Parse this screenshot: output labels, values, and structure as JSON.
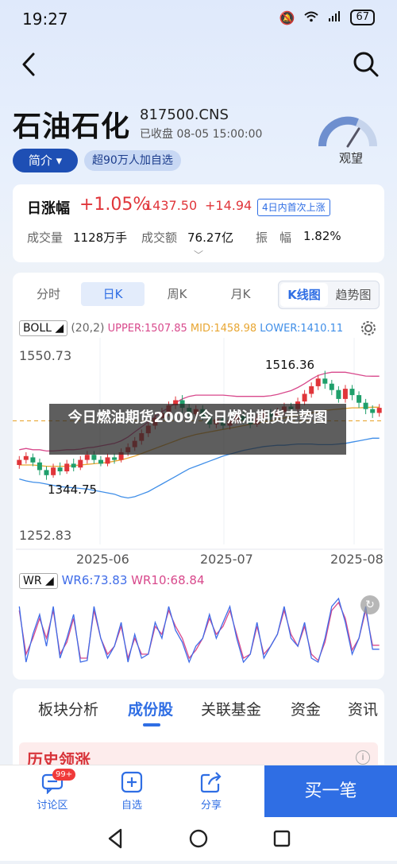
{
  "status": {
    "time": "19:27",
    "battery": "67"
  },
  "header": {
    "stock_name": "石油石化",
    "code": "817500.CNS",
    "status": "已收盘 08-05 15:00:00",
    "intro": "简介",
    "watch": "超90万人加自选",
    "gauge_label": "观望"
  },
  "quote": {
    "label": "日涨幅",
    "change_pct": "+1.05%",
    "price": "1437.50",
    "change": "+14.94",
    "badge": "4日内首次上涨",
    "volume_label": "成交量",
    "volume": "1128万手",
    "amount_label": "成交额",
    "amount": "76.27亿",
    "amplitude_label": "振　幅",
    "amplitude": "1.82%"
  },
  "chart_tabs": [
    "分时",
    "日K",
    "周K",
    "月K"
  ],
  "chart_mode": [
    "K线图",
    "趋势图"
  ],
  "boll": {
    "name": "BOLL",
    "params": "(20,2)",
    "upper": "UPPER:1507.85",
    "mid": "MID:1458.98",
    "lower": "LOWER:1410.11"
  },
  "wr": {
    "name": "WR",
    "wr6": "WR6:73.83",
    "wr10": "WR10:68.84"
  },
  "overlay_text": "今日燃油期货2009/今日燃油期货走势图",
  "colors": {
    "up": "#e0353a",
    "down": "#1f9f6b",
    "upper": "#d8498c",
    "mid": "#e8a632",
    "lower": "#3f8ee8",
    "wr6": "#3f6ce8",
    "wr10": "#d8498c",
    "accent": "#2f6ee4"
  },
  "chart_data": {
    "type": "candlestick",
    "ylim": [
      1252.83,
      1550.73
    ],
    "y_ticks": [
      "1550.73",
      "1252.83"
    ],
    "x_ticks": [
      "2025-06",
      "2025-07",
      "2025-08"
    ],
    "high_label": "1516.36",
    "low_label": "1344.75",
    "candles": [
      {
        "o": 1368,
        "c": 1376,
        "h": 1382,
        "l": 1362
      },
      {
        "o": 1376,
        "c": 1382,
        "h": 1388,
        "l": 1370
      },
      {
        "o": 1380,
        "c": 1372,
        "h": 1386,
        "l": 1366
      },
      {
        "o": 1372,
        "c": 1360,
        "h": 1378,
        "l": 1352
      },
      {
        "o": 1360,
        "c": 1352,
        "h": 1366,
        "l": 1344.75
      },
      {
        "o": 1352,
        "c": 1364,
        "h": 1370,
        "l": 1348
      },
      {
        "o": 1364,
        "c": 1358,
        "h": 1372,
        "l": 1352
      },
      {
        "o": 1358,
        "c": 1370,
        "h": 1376,
        "l": 1354
      },
      {
        "o": 1370,
        "c": 1364,
        "h": 1378,
        "l": 1358
      },
      {
        "o": 1364,
        "c": 1376,
        "h": 1382,
        "l": 1360
      },
      {
        "o": 1376,
        "c": 1384,
        "h": 1390,
        "l": 1370
      },
      {
        "o": 1384,
        "c": 1376,
        "h": 1390,
        "l": 1370
      },
      {
        "o": 1376,
        "c": 1370,
        "h": 1382,
        "l": 1366
      },
      {
        "o": 1370,
        "c": 1380,
        "h": 1386,
        "l": 1366
      },
      {
        "o": 1380,
        "c": 1376,
        "h": 1386,
        "l": 1370
      },
      {
        "o": 1376,
        "c": 1388,
        "h": 1394,
        "l": 1372
      },
      {
        "o": 1388,
        "c": 1396,
        "h": 1402,
        "l": 1382
      },
      {
        "o": 1396,
        "c": 1406,
        "h": 1412,
        "l": 1390
      },
      {
        "o": 1406,
        "c": 1418,
        "h": 1424,
        "l": 1400
      },
      {
        "o": 1418,
        "c": 1430,
        "h": 1436,
        "l": 1412
      },
      {
        "o": 1430,
        "c": 1442,
        "h": 1448,
        "l": 1424
      },
      {
        "o": 1442,
        "c": 1450,
        "h": 1458,
        "l": 1436
      },
      {
        "o": 1450,
        "c": 1462,
        "h": 1468,
        "l": 1444
      },
      {
        "o": 1462,
        "c": 1470,
        "h": 1476,
        "l": 1456
      },
      {
        "o": 1470,
        "c": 1458,
        "h": 1478,
        "l": 1450
      },
      {
        "o": 1458,
        "c": 1448,
        "h": 1464,
        "l": 1440
      },
      {
        "o": 1448,
        "c": 1456,
        "h": 1462,
        "l": 1442
      },
      {
        "o": 1456,
        "c": 1444,
        "h": 1462,
        "l": 1438
      },
      {
        "o": 1444,
        "c": 1432,
        "h": 1450,
        "l": 1426
      },
      {
        "o": 1432,
        "c": 1440,
        "h": 1446,
        "l": 1426
      },
      {
        "o": 1440,
        "c": 1430,
        "h": 1446,
        "l": 1424
      },
      {
        "o": 1430,
        "c": 1438,
        "h": 1444,
        "l": 1424
      },
      {
        "o": 1438,
        "c": 1446,
        "h": 1452,
        "l": 1432
      },
      {
        "o": 1446,
        "c": 1438,
        "h": 1452,
        "l": 1432
      },
      {
        "o": 1438,
        "c": 1432,
        "h": 1444,
        "l": 1426
      },
      {
        "o": 1432,
        "c": 1442,
        "h": 1448,
        "l": 1428
      },
      {
        "o": 1442,
        "c": 1450,
        "h": 1456,
        "l": 1436
      },
      {
        "o": 1450,
        "c": 1444,
        "h": 1456,
        "l": 1438
      },
      {
        "o": 1444,
        "c": 1452,
        "h": 1458,
        "l": 1440
      },
      {
        "o": 1452,
        "c": 1460,
        "h": 1466,
        "l": 1446
      },
      {
        "o": 1460,
        "c": 1456,
        "h": 1466,
        "l": 1450
      },
      {
        "o": 1456,
        "c": 1468,
        "h": 1474,
        "l": 1452
      },
      {
        "o": 1468,
        "c": 1480,
        "h": 1486,
        "l": 1462
      },
      {
        "o": 1480,
        "c": 1492,
        "h": 1498,
        "l": 1474
      },
      {
        "o": 1492,
        "c": 1504,
        "h": 1510,
        "l": 1486
      },
      {
        "o": 1504,
        "c": 1496,
        "h": 1516.36,
        "l": 1488
      },
      {
        "o": 1496,
        "c": 1486,
        "h": 1502,
        "l": 1478
      },
      {
        "o": 1486,
        "c": 1472,
        "h": 1492,
        "l": 1466
      },
      {
        "o": 1472,
        "c": 1488,
        "h": 1494,
        "l": 1466
      },
      {
        "o": 1488,
        "c": 1478,
        "h": 1494,
        "l": 1470
      },
      {
        "o": 1478,
        "c": 1466,
        "h": 1484,
        "l": 1458
      },
      {
        "o": 1466,
        "c": 1456,
        "h": 1472,
        "l": 1448
      },
      {
        "o": 1456,
        "c": 1450,
        "h": 1462,
        "l": 1442
      },
      {
        "o": 1450,
        "c": 1458,
        "h": 1464,
        "l": 1444
      }
    ],
    "upper": [
      1392,
      1394,
      1392,
      1392,
      1390,
      1390,
      1391,
      1392,
      1392,
      1393,
      1395,
      1396,
      1398,
      1400,
      1402,
      1406,
      1412,
      1420,
      1428,
      1436,
      1444,
      1452,
      1458,
      1466,
      1472,
      1476,
      1478,
      1478,
      1478,
      1478,
      1478,
      1477,
      1476,
      1476,
      1476,
      1476,
      1476,
      1477,
      1479,
      1482,
      1485,
      1490,
      1496,
      1503,
      1509,
      1512,
      1514,
      1514,
      1514,
      1512,
      1510,
      1508,
      1507.85,
      1507.85
    ],
    "mid": [
      1368,
      1368,
      1368,
      1367,
      1366,
      1366,
      1366,
      1366,
      1367,
      1368,
      1369,
      1370,
      1371,
      1372,
      1374,
      1376,
      1379,
      1382,
      1386,
      1390,
      1394,
      1398,
      1402,
      1406,
      1410,
      1413,
      1416,
      1418,
      1420,
      1422,
      1424,
      1426,
      1428,
      1430,
      1432,
      1434,
      1436,
      1438,
      1440,
      1442,
      1444,
      1446,
      1448,
      1450,
      1452,
      1454,
      1455,
      1456,
      1457,
      1458,
      1458,
      1458.5,
      1458.98,
      1458.98
    ],
    "lower": [
      1346,
      1343,
      1341,
      1340,
      1338,
      1336,
      1334,
      1333,
      1332,
      1331,
      1330,
      1328,
      1326,
      1324,
      1322,
      1318,
      1316,
      1318,
      1322,
      1326,
      1332,
      1338,
      1344,
      1350,
      1356,
      1362,
      1366,
      1370,
      1374,
      1378,
      1382,
      1385,
      1388,
      1391,
      1393,
      1395,
      1397,
      1398,
      1399,
      1399,
      1400,
      1401,
      1401,
      1401,
      1400,
      1400,
      1400,
      1401,
      1402,
      1404,
      1406,
      1408,
      1410.11,
      1410.11
    ],
    "dashed_price": 1437.5,
    "wr6": [
      20,
      90,
      55,
      30,
      70,
      20,
      85,
      60,
      30,
      90,
      88,
      20,
      60,
      85,
      70,
      40,
      90,
      55,
      85,
      80,
      40,
      60,
      20,
      50,
      65,
      90,
      70,
      60,
      30,
      60,
      40,
      20,
      60,
      90,
      80,
      40,
      85,
      70,
      55,
      20,
      60,
      70,
      40,
      85,
      90,
      60,
      20,
      10,
      40,
      80,
      60,
      20,
      73.83,
      73.83
    ],
    "wr10": [
      25,
      80,
      60,
      35,
      60,
      25,
      80,
      65,
      35,
      85,
      85,
      25,
      60,
      80,
      70,
      45,
      85,
      60,
      80,
      80,
      45,
      55,
      25,
      45,
      60,
      85,
      75,
      60,
      35,
      55,
      45,
      25,
      55,
      85,
      80,
      45,
      80,
      70,
      55,
      25,
      55,
      70,
      45,
      80,
      88,
      65,
      25,
      15,
      35,
      75,
      60,
      25,
      68.84,
      68.84
    ]
  },
  "detail_tabs": [
    "板块分析",
    "成份股",
    "关联基金",
    "资金",
    "资讯"
  ],
  "history_title": "历史领涨",
  "bottom_nav": {
    "discuss": "讨论区",
    "discuss_badge": "99+",
    "watch": "自选",
    "share": "分享",
    "buy": "买一笔"
  }
}
